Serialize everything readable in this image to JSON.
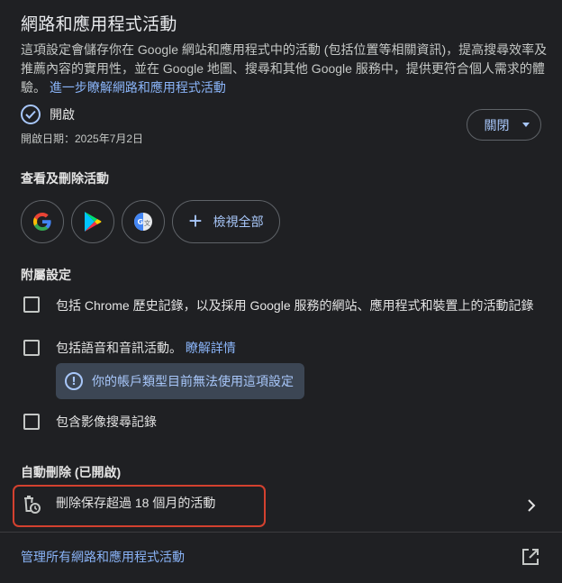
{
  "header": {
    "title": "網路和應用程式活動",
    "description": "這項設定會儲存你在 Google 網站和應用程式中的活動 (包括位置等相關資訊)，提高搜尋效率及推薦內容的實用性，並在 Google 地圖、搜尋和其他 Google 服務中，提供更符合個人需求的體驗。",
    "learn_more": "進一步瞭解網路和應用程式活動"
  },
  "status": {
    "label": "開啟",
    "date": "開啟日期：2025年7月2日",
    "off_button": "關閉"
  },
  "view_delete": {
    "title": "查看及刪除活動",
    "apps": [
      "google-icon",
      "google-play-icon",
      "google-translate-icon"
    ],
    "view_all": "檢視全部"
  },
  "sub_settings": {
    "title": "附屬設定",
    "chrome_history": "包括 Chrome 歷史記錄，以及採用 Google 服務的網站、應用程式和裝置上的活動記錄",
    "audio_activity": "包括語音和音訊活動。",
    "audio_learn_more": "瞭解詳情",
    "info_message": "你的帳戶類型目前無法使用這項設定",
    "image_search": "包含影像搜尋記錄"
  },
  "auto_delete": {
    "title": "自動刪除 (已開啟)",
    "rule": "刪除保存超過 18 個月的活動"
  },
  "footer": {
    "manage_link": "管理所有網路和應用程式活動"
  },
  "colors": {
    "background": "#1f2023",
    "accent": "#a8c7fa",
    "link": "#8ab4f8",
    "highlight_border": "#d3412f"
  }
}
